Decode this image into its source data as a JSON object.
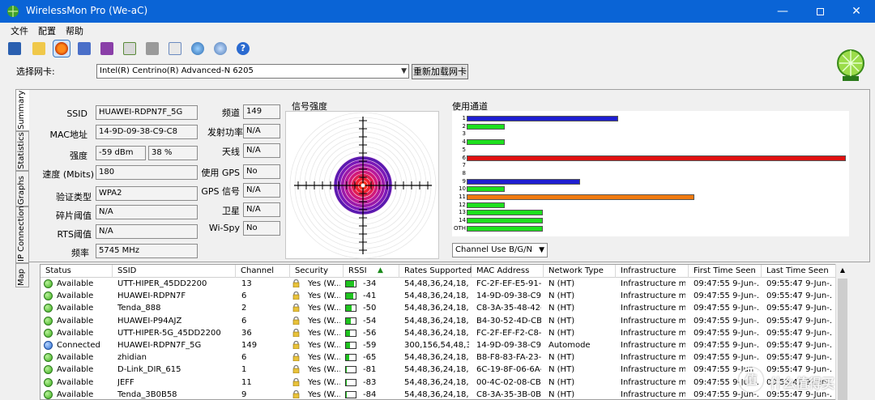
{
  "window": {
    "title": "WirelessMon Pro (We-aC)"
  },
  "menu": [
    "文件",
    "配置",
    "帮助"
  ],
  "toolbar": [
    "save-icon",
    "open-folder-icon",
    "record-icon",
    "network-icon",
    "network-add-icon",
    "export-icon",
    "print-icon",
    "check-icon",
    "globe-icon",
    "help-globe-icon",
    "help-icon"
  ],
  "adapter": {
    "label": "选择网卡:",
    "value": "Intel(R) Centrino(R) Advanced-N 6205",
    "reload": "重新加载网卡"
  },
  "tabs": [
    "Summary",
    "Statistics",
    "Graphs",
    "IP Connection",
    "Map"
  ],
  "summary": {
    "ssid_label": "SSID",
    "ssid": "HUAWEI-RDPN7F_5G",
    "mac_label": "MAC地址",
    "mac": "14-9D-09-38-C9-C8",
    "strength_label": "强度",
    "strength_dbm": "-59 dBm",
    "strength_pct": "38 %",
    "speed_label": "速度 (Mbits)",
    "speed": "180",
    "auth_label": "验证类型",
    "auth": "WPA2",
    "frag_label": "碎片阈值",
    "frag": "N/A",
    "rts_label": "RTS阈值",
    "rts": "N/A",
    "freq_label": "频率",
    "freq": "5745 MHz",
    "channel_label": "频道",
    "channel": "149",
    "tx_label": "发射功率",
    "tx": "N/A",
    "antenna_label": "天线",
    "antenna": "N/A",
    "gps_label": "使用 GPS",
    "gps": "No",
    "gps_signal_label": "GPS 信号",
    "gps_signal": "N/A",
    "satellite_label": "卫星",
    "satellite": "N/A",
    "wispy_label": "Wi-Spy",
    "wispy": "No"
  },
  "signal": {
    "title": "信号强度",
    "level_pct": 38
  },
  "channel_usage": {
    "title": "使用通道",
    "mode": "Channel Use B/G/N",
    "labels": [
      "1",
      "2",
      "3",
      "4",
      "5",
      "6",
      "7",
      "8",
      "9",
      "10",
      "11",
      "12",
      "13",
      "14",
      "OTH"
    ],
    "values": [
      4,
      1,
      0,
      1,
      0,
      10,
      0,
      0,
      3,
      1,
      6,
      1,
      2,
      2,
      2
    ],
    "max": 10,
    "colors": [
      "#1f1fd0",
      "#1ee01e",
      "#1ee01e",
      "#1ee01e",
      "#1ee01e",
      "#e01010",
      "#1ee01e",
      "#1ee01e",
      "#1f1fd0",
      "#1ee01e",
      "#f07a10",
      "#1ee01e",
      "#1ee01e",
      "#1ee01e",
      "#1ee01e"
    ]
  },
  "table": {
    "headers": [
      "Status",
      "SSID",
      "Channel",
      "Security",
      "RSSI",
      "Rates Supported",
      "MAC Address",
      "Network Type",
      "Infrastructure",
      "First Time Seen",
      "Last Time Seen"
    ],
    "rows": [
      {
        "status": "Available",
        "ssid": "UTT-HIPER_45DD2200",
        "channel": "13",
        "security": "Yes (W...",
        "rssi": "-34",
        "rssi_fill": 0.85,
        "rates": "54,48,36,24,18,...",
        "mac": "FC-2F-EF-E5-91-...",
        "type": "N (HT)",
        "infra": "Infrastructure mo...",
        "first": "09:47:55 9-Jun-...",
        "last": "09:55:47 9-Jun-..."
      },
      {
        "status": "Available",
        "ssid": "HUAWEI-RDPN7F",
        "channel": "6",
        "security": "Yes (W...",
        "rssi": "-41",
        "rssi_fill": 0.75,
        "rates": "54,48,36,24,18,...",
        "mac": "14-9D-09-38-C9-...",
        "type": "N (HT)",
        "infra": "Infrastructure mo...",
        "first": "09:47:55 9-Jun-...",
        "last": "09:55:47 9-Jun-..."
      },
      {
        "status": "Available",
        "ssid": "Tenda_888",
        "channel": "2",
        "security": "Yes (W...",
        "rssi": "-50",
        "rssi_fill": 0.55,
        "rates": "54,48,36,24,18,...",
        "mac": "C8-3A-35-48-42-...",
        "type": "N (HT)",
        "infra": "Infrastructure mo...",
        "first": "09:47:55 9-Jun-...",
        "last": "09:55:47 9-Jun-..."
      },
      {
        "status": "Available",
        "ssid": "HUAWEI-P94AJZ",
        "channel": "6",
        "security": "Yes (W...",
        "rssi": "-54",
        "rssi_fill": 0.5,
        "rates": "54,48,36,24,18,...",
        "mac": "B4-30-52-4D-CB-...",
        "type": "N (HT)",
        "infra": "Infrastructure mo...",
        "first": "09:47:55 9-Jun-...",
        "last": "09:55:47 9-Jun-..."
      },
      {
        "status": "Available",
        "ssid": "UTT-HIPER-5G_45DD2200",
        "channel": "36",
        "security": "Yes (W...",
        "rssi": "-56",
        "rssi_fill": 0.45,
        "rates": "54,48,36,24,18,...",
        "mac": "FC-2F-EF-F2-C8-...",
        "type": "N (HT)",
        "infra": "Infrastructure mo...",
        "first": "09:47:55 9-Jun-...",
        "last": "09:55:47 9-Jun-..."
      },
      {
        "status": "Connected",
        "ssid": "HUAWEI-RDPN7F_5G",
        "channel": "149",
        "security": "Yes (W...",
        "rssi": "-59",
        "rssi_fill": 0.4,
        "rates": "300,156,54,48,3...",
        "mac": "14-9D-09-38-C9-...",
        "type": "Automode",
        "infra": "Infrastructure mo...",
        "first": "09:47:55 9-Jun-...",
        "last": "09:55:47 9-Jun-..."
      },
      {
        "status": "Available",
        "ssid": "zhidian",
        "channel": "6",
        "security": "Yes (W...",
        "rssi": "-65",
        "rssi_fill": 0.3,
        "rates": "54,48,36,24,18,...",
        "mac": "B8-F8-83-FA-23-...",
        "type": "N (HT)",
        "infra": "Infrastructure mo...",
        "first": "09:47:55 9-Jun-...",
        "last": "09:55:47 9-Jun-..."
      },
      {
        "status": "Available",
        "ssid": "D-Link_DIR_615",
        "channel": "1",
        "security": "Yes (W...",
        "rssi": "-81",
        "rssi_fill": 0.1,
        "rates": "54,48,36,24,18,...",
        "mac": "6C-19-8F-06-6A-...",
        "type": "N (HT)",
        "infra": "Infrastructure mo...",
        "first": "09:47:55 9-Jun-...",
        "last": "09:55:47 9-Jun-..."
      },
      {
        "status": "Available",
        "ssid": "JEFF",
        "channel": "11",
        "security": "Yes (W...",
        "rssi": "-83",
        "rssi_fill": 0.08,
        "rates": "54,48,36,24,18,...",
        "mac": "00-4C-02-08-CB-...",
        "type": "N (HT)",
        "infra": "Infrastructure mo...",
        "first": "09:47:55 9-Jun-...",
        "last": "09:55:47 9-Jun-..."
      },
      {
        "status": "Available",
        "ssid": "Tenda_3B0B58",
        "channel": "9",
        "security": "Yes (W...",
        "rssi": "-84",
        "rssi_fill": 0.06,
        "rates": "54,48,36,24,18,...",
        "mac": "C8-3A-35-3B-0B-...",
        "type": "N (HT)",
        "infra": "Infrastructure mo...",
        "first": "09:47:55 9-Jun-...",
        "last": "09:55:47 9-Jun-..."
      }
    ]
  },
  "watermark": {
    "mark": "值",
    "text": "什么值得买"
  }
}
